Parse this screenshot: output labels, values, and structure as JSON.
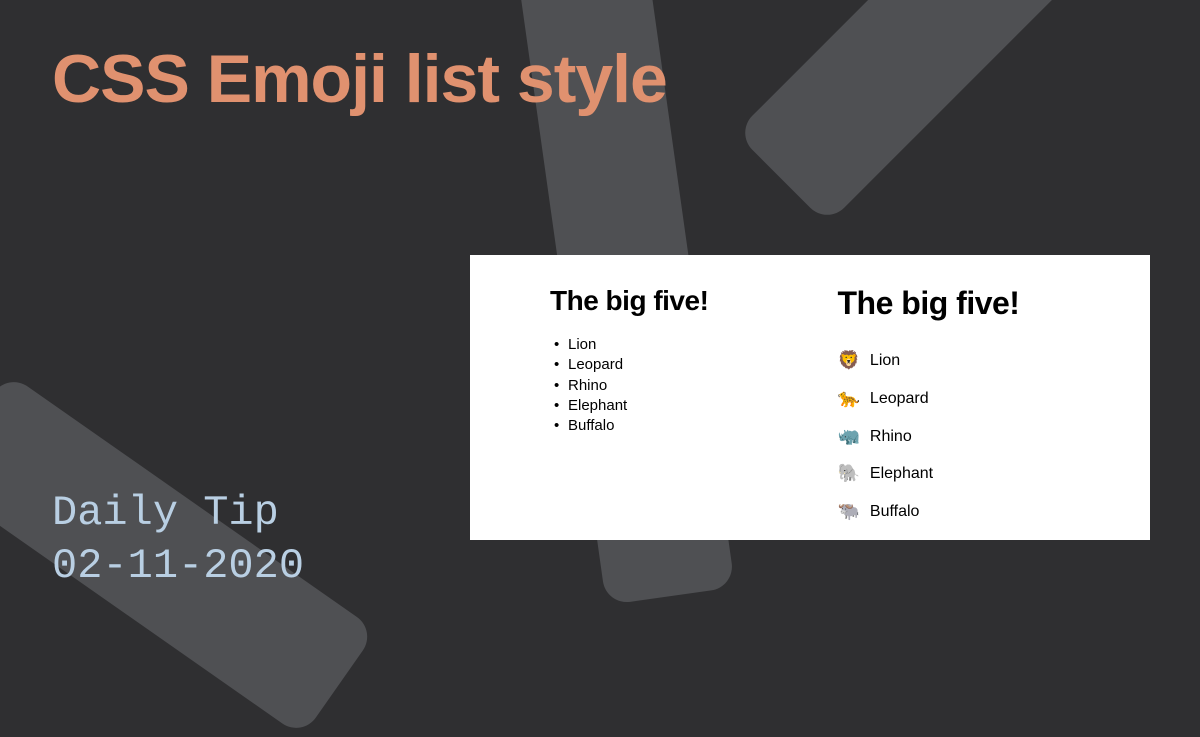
{
  "title": "CSS Emoji list style",
  "subtitle_line1": "Daily Tip",
  "subtitle_line2": "02-11-2020",
  "preview": {
    "heading": "The big five!",
    "animals": [
      {
        "name": "Lion",
        "emoji": "🦁"
      },
      {
        "name": "Leopard",
        "emoji": "🐆"
      },
      {
        "name": "Rhino",
        "emoji": "🦏"
      },
      {
        "name": "Elephant",
        "emoji": "🐘"
      },
      {
        "name": "Buffalo",
        "emoji": "🐃"
      }
    ]
  },
  "colors": {
    "background": "#2f2f31",
    "shapes": "#4f5053",
    "title": "#e0916f",
    "subtitle": "#b9cfe3",
    "card": "#ffffff"
  }
}
